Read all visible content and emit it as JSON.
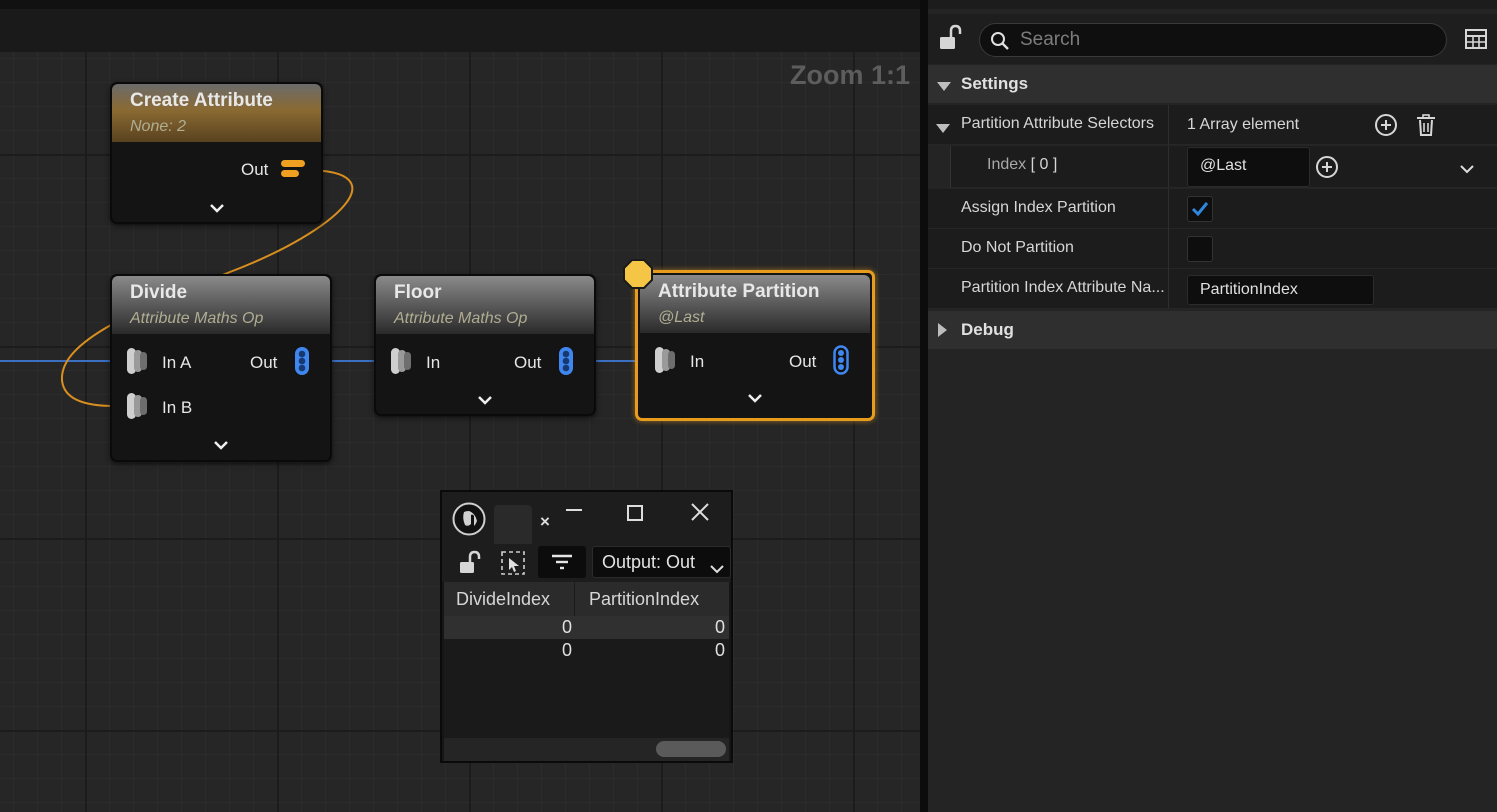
{
  "graph": {
    "zoom_label": "Zoom 1:1",
    "nodes": {
      "create_attribute": {
        "title": "Create Attribute",
        "subtitle": "None: 2",
        "out_label": "Out"
      },
      "divide": {
        "title": "Divide",
        "subtitle": "Attribute Maths Op",
        "in_a_label": "In A",
        "in_b_label": "In B",
        "out_label": "Out"
      },
      "floor": {
        "title": "Floor",
        "subtitle": "Attribute Maths Op",
        "in_label": "In",
        "out_label": "Out"
      },
      "attribute_partition": {
        "title": "Attribute Partition",
        "subtitle": "@Last",
        "in_label": "In",
        "out_label": "Out"
      }
    },
    "colors": {
      "wire_blue": "#3a6fc2",
      "wire_orange": "#d88f1f",
      "selected_border": "#e89c1e",
      "pin_blue": "#3f86ef",
      "pin_orange": "#f0a020"
    }
  },
  "details_panel": {
    "search": {
      "placeholder": "Search",
      "value": ""
    },
    "sections": {
      "settings": "Settings",
      "debug": "Debug"
    },
    "properties": {
      "partition_attribute_selectors": {
        "label": "Partition Attribute Selectors",
        "value": "1 Array element"
      },
      "index_0": {
        "label": "Index",
        "index_bracket": "[ 0 ]",
        "value": "@Last"
      },
      "assign_index_partition": {
        "label": "Assign Index Partition",
        "checked": true
      },
      "do_not_partition": {
        "label": "Do Not Partition",
        "checked": false
      },
      "partition_index_attribute_name": {
        "label": "Partition Index Attribute Na...",
        "value": "PartitionIndex"
      }
    },
    "colors": {
      "accent": "#1e7ad8",
      "check": "#2f86e0"
    }
  },
  "attribute_window": {
    "tab_close": "×",
    "output_select": "Output: Out",
    "columns": [
      "DivideIndex",
      "PartitionIndex"
    ],
    "rows": [
      [
        "0",
        "0"
      ],
      [
        "0",
        "0"
      ]
    ]
  }
}
